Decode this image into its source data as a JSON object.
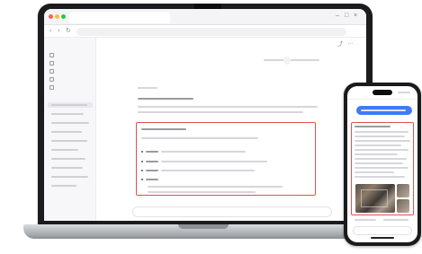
{
  "desktop": {
    "tab_title": "",
    "url": "",
    "chat_title": "",
    "user_message": "",
    "thinking_label": "",
    "section_title": "",
    "highlight_title": "",
    "highlight_labels": [
      "",
      "",
      "",
      ""
    ],
    "window_controls": {
      "minimize": "–",
      "maximize": "□",
      "close": "×"
    },
    "nav_icons": {
      "back": "‹",
      "forward": "›",
      "reload": "↻"
    },
    "top_icons": "⤴ ⋯"
  },
  "sidebar": {
    "logo_label": "",
    "nav_items": [
      "",
      "",
      "",
      "",
      ""
    ],
    "conversation_count": 10
  },
  "phone": {
    "status_time": ""
  },
  "colors": {
    "highlight_border": "#e2504c",
    "phone_query_bubble": "#3e7bf6",
    "laptop_body": "#1c1c1e",
    "base_metal": "#a7aaae"
  },
  "icons": [
    "back-icon",
    "forward-icon",
    "reload-icon",
    "share-icon",
    "more-icon",
    "sidebar-nav-icon"
  ]
}
